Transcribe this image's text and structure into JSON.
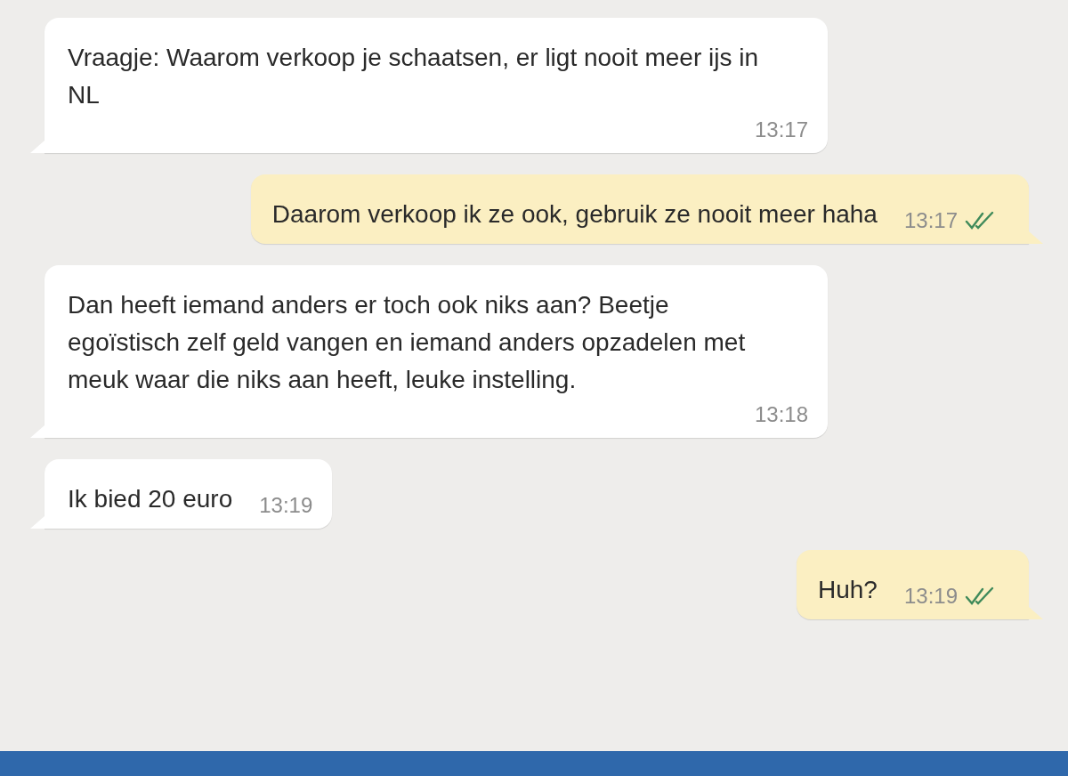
{
  "messages": [
    {
      "outgoing": false,
      "text": "Vraagje: Waarom verkoop je schaatsen, er ligt nooit meer ijs in NL",
      "time": "13:17"
    },
    {
      "outgoing": true,
      "text": "Daarom verkoop ik ze ook, gebruik ze nooit meer haha",
      "time": "13:17",
      "read": true
    },
    {
      "outgoing": false,
      "text": "Dan heeft iemand anders er toch ook niks aan? Beetje egoïstisch zelf geld vangen en iemand anders opzadelen met meuk waar die niks aan heeft, leuke instelling.",
      "time": "13:18"
    },
    {
      "outgoing": false,
      "text": "Ik bied 20 euro",
      "time": "13:19"
    },
    {
      "outgoing": true,
      "text": "Huh?",
      "time": "13:19",
      "read": true
    }
  ]
}
